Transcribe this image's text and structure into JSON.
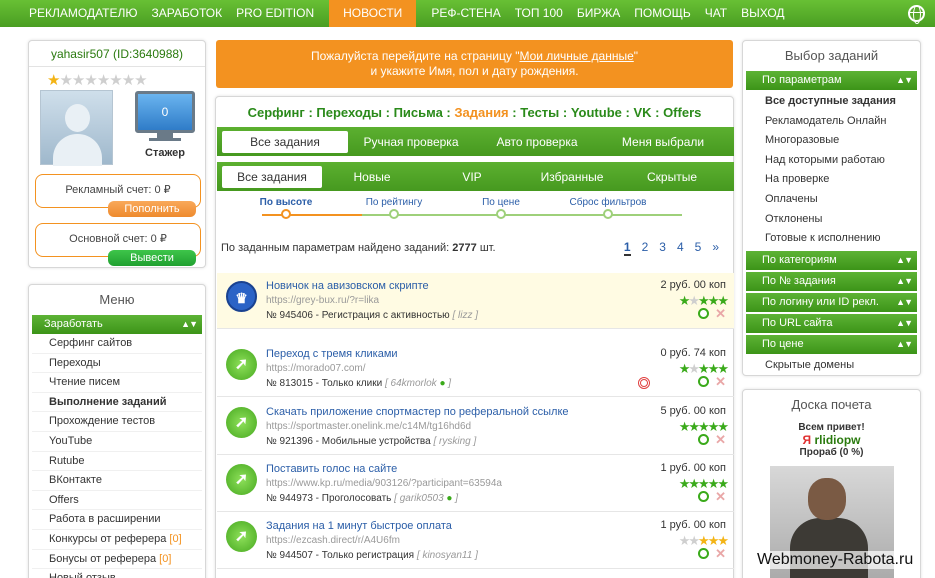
{
  "topnav": {
    "items": [
      "РЕКЛАМОДАТЕЛЮ",
      "ЗАРАБОТОК",
      "PRO EDITION",
      "НОВОСТИ",
      "РЕФ-СТЕНА",
      "ТОП 100",
      "БИРЖА",
      "ПОМОЩЬ",
      "ЧАТ",
      "ВЫХОД"
    ],
    "active_index": 3
  },
  "user": {
    "name": "yahasir507 (ID:3640988)",
    "rating_stars": {
      "filled": 1,
      "total": 8
    },
    "monitor_value": "0",
    "rank": "Стажер",
    "ad_account": "Рекламный счет: 0 ₽",
    "topup_button": "Пополнить",
    "main_account": "Основной счет: 0 ₽",
    "withdraw_button": "Вывести"
  },
  "menu": {
    "title": "Меню",
    "section": "Заработать",
    "items": [
      {
        "label": "Серфинг сайтов"
      },
      {
        "label": "Переходы"
      },
      {
        "label": "Чтение писем"
      },
      {
        "label": "Выполнение заданий",
        "bold": true
      },
      {
        "label": "Прохождение тестов"
      },
      {
        "label": "YouTube"
      },
      {
        "label": "Rutube"
      },
      {
        "label": "ВКонтакте"
      },
      {
        "label": "Offers"
      },
      {
        "label": "Работа в расширении"
      },
      {
        "label": "Конкурсы от реферера",
        "count": "[0]"
      },
      {
        "label": "Бонусы от реферера",
        "count": "[0]"
      },
      {
        "label": "Новый отзыв"
      }
    ]
  },
  "notice": {
    "line1_pre": "Пожалуйста перейдите на страницу \"",
    "link": "Мои личные данные",
    "line1_post": "\"",
    "line2": "и укажите Имя, пол и дату рождения."
  },
  "categories": {
    "items": [
      "Серфинг",
      "Переходы",
      "Письма",
      "Задания",
      "Тесты",
      "Youtube",
      "VK",
      "Offers"
    ],
    "separator": " : ",
    "active_index": 3
  },
  "tabs1": {
    "items": [
      "Все задания",
      "Ручная проверка",
      "Авто проверка",
      "Меня выбрали"
    ],
    "active_index": 0
  },
  "tabs2": {
    "items": [
      "Все задания",
      "Новые",
      "VIP",
      "Избранные",
      "Скрытые"
    ],
    "active_index": 0
  },
  "sorts": {
    "items": [
      "По высоте",
      "По рейтингу",
      "По цене",
      "Сброс фильтров"
    ],
    "active_index": 0
  },
  "found": {
    "text": "По заданным параметрам найдено заданий:",
    "count": "2777",
    "unit": "шт."
  },
  "pagination": {
    "pages": [
      "1",
      "2",
      "3",
      "4",
      "5",
      "»"
    ],
    "current": "1"
  },
  "tasks": [
    {
      "title": "Новичок на авизовском скрипте",
      "url": "https://grey-bux.ru/?r=lika",
      "id": "№ 945406",
      "type": "Регистрация с активностью",
      "author": "lizz",
      "online": false,
      "price": "2 руб. 00 коп",
      "stars": "gsggg",
      "icon": "crown",
      "highlight": true,
      "target": false
    },
    {
      "title": "Переход с тремя кликами",
      "url": "https://morado07.com/",
      "id": "№ 813015",
      "type": "Только клики",
      "author": "64kmorlok",
      "online": true,
      "price": "0 руб. 74 коп",
      "stars": "gsggg",
      "icon": "arrow",
      "highlight": false,
      "target": true
    },
    {
      "title": "Скачать приложение спортмастер по реферальной ссылке",
      "url": "https://sportmaster.onelink.me/c14M/tg16hd6d",
      "id": "№ 921396",
      "type": "Мобильные устройства",
      "author": "rysking",
      "online": false,
      "price": "5 руб. 00 коп",
      "stars": "ggggg",
      "icon": "arrow",
      "highlight": false,
      "target": false
    },
    {
      "title": "Поставить голос на сайте",
      "url": "https://www.kp.ru/media/903126/?participant=63594a",
      "id": "№ 944973",
      "type": "Проголосовать",
      "author": "garik0503",
      "online": true,
      "price": "1 руб. 00 коп",
      "stars": "ggggg",
      "icon": "arrow",
      "highlight": false,
      "target": false
    },
    {
      "title": "Задания на 1 минут быстрое оплата",
      "url": "https://ezcash.direct/r/A4U6fm",
      "id": "№ 944507",
      "type": "Только регистрация",
      "author": "kinosyan11",
      "online": false,
      "price": "1 руб. 00 коп",
      "stars": "ssooo",
      "icon": "arrow",
      "highlight": false,
      "target": false
    }
  ],
  "choose": {
    "title": "Выбор заданий",
    "section1": "По параметрам",
    "params": [
      {
        "label": "Все доступные задания",
        "bold": true
      },
      {
        "label": "Рекламодатель Онлайн"
      },
      {
        "label": "Многоразовые"
      },
      {
        "label": "Над которыми работаю"
      },
      {
        "label": "На проверке"
      },
      {
        "label": "Оплачены"
      },
      {
        "label": "Отклонены"
      },
      {
        "label": "Готовые к исполнению"
      }
    ],
    "sections": [
      "По категориям",
      "По № задания",
      "По логину или ID рекл.",
      "По URL сайта",
      "По цене"
    ],
    "last_item": "Скрытые домены"
  },
  "honor": {
    "title": "Доска почета",
    "greeting": "Всем привет!",
    "name_prefix": "Я",
    "name": "rlidiopw",
    "percent": "Прораб (0 %)"
  },
  "watermark": "Webmoney-Rabota.ru",
  "colors": {
    "green": "#4a9e22",
    "orange": "#f39220",
    "link": "#2b5ea8"
  }
}
